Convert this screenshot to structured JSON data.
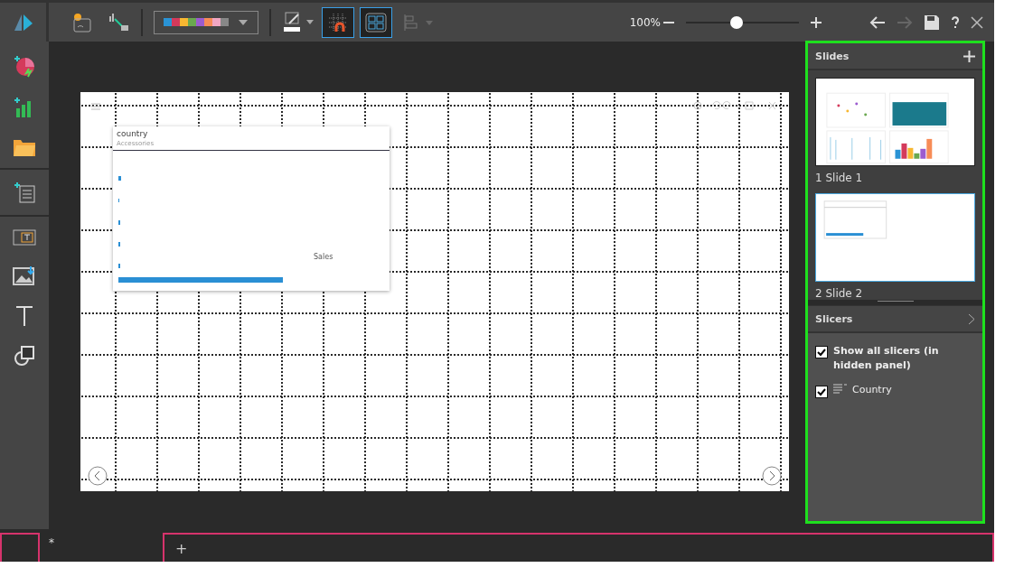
{
  "toolbar": {
    "zoom_reading": "100%",
    "zoom": {
      "level": 0.45
    },
    "toggles": [
      {
        "kind": "snap",
        "selected": true
      },
      {
        "kind": "layout",
        "selected": true
      }
    ]
  },
  "canvas": {
    "widget": {
      "title": "country",
      "subtitle": "Accessories",
      "axis_label": "Sales"
    }
  },
  "slides_panel": {
    "title": "Slides",
    "slides": [
      {
        "label": "1 Slide 1",
        "kind": "dashboard",
        "selected": false
      },
      {
        "label": "2 Slide 2",
        "kind": "single",
        "selected": true
      }
    ]
  },
  "slicers_panel": {
    "title": "Slicers",
    "items": [
      {
        "label": "Show all slicers (in hidden panel)",
        "kind": "option",
        "checked": true
      },
      {
        "label": "Country",
        "kind": "slicer",
        "checked": true
      }
    ]
  },
  "bottom_bar": {
    "tab": "*",
    "add": "+"
  }
}
